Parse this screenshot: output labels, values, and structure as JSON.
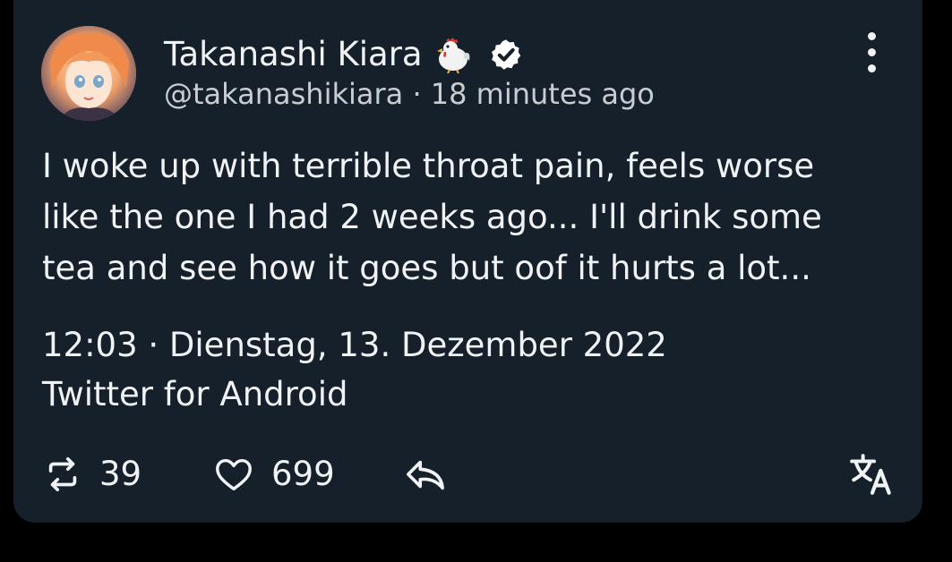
{
  "author": {
    "display_name": "Takanashi Kiara",
    "name_emoji": "chicken-emoji",
    "verified_badge": "verified-icon",
    "handle_line": "@takanashikiara · 18 minutes ago",
    "avatar": "avatar"
  },
  "tweet": {
    "text": "I woke up with terrible throat pain, feels worse\nlike the one I had 2 weeks ago... I'll drink some\ntea and see how it goes but oof it hurts a lot...",
    "timestamp": "12:03 · Dienstag, 13. Dezember 2022",
    "source": "Twitter for Android"
  },
  "actions": {
    "retweet": {
      "icon": "retweet-icon",
      "count": "39"
    },
    "like": {
      "icon": "heart-icon",
      "count": "699"
    },
    "reply": {
      "icon": "reply-icon"
    },
    "translate": {
      "icon": "translate-icon"
    },
    "more": {
      "icon": "more-vertical-icon"
    }
  },
  "colors": {
    "card_background": "#15202b",
    "page_background": "#000000",
    "text": "#f0f2f3",
    "secondary_text": "#c9cdd1"
  }
}
